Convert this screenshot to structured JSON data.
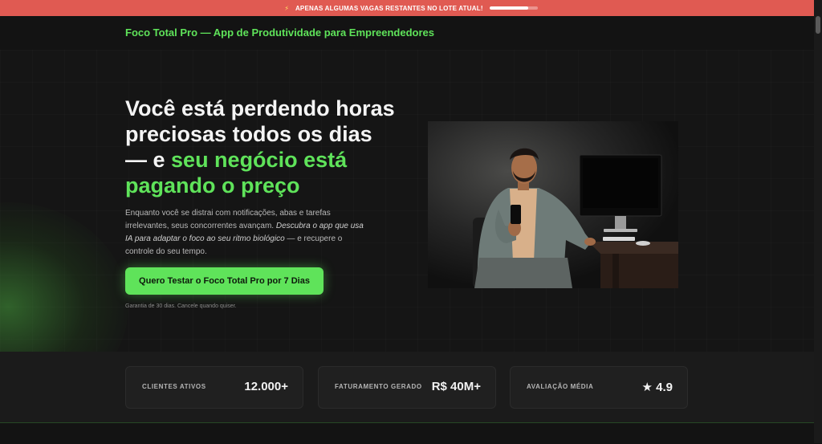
{
  "announcement": {
    "text": "APENAS ALGUMAS VAGAS RESTANTES NO LOTE ATUAL!",
    "icon": "lightning-icon",
    "progress": 0.8
  },
  "header": {
    "brand": "Foco Total Pro — App de Produtividade para Empreendedores"
  },
  "hero": {
    "headline_plain": "Você está perdendo horas preciosas todos os dias — e ",
    "headline_accent": "seu negócio está pagando o preço",
    "description_plain": "Enquanto você se distrai com notificações, abas e tarefas irrelevantes, seus concorrentes avançam. ",
    "description_italic": "Descubra o app que usa IA para adaptar o foco ao seu ritmo biológico",
    "description_end": " — e recupere o controle do seu tempo.",
    "cta_label": "Quero Testar o Foco Total Pro por 7 Dias",
    "guarantee": "Garantia de 30 dias. Cancele quando quiser."
  },
  "stats": [
    {
      "label": "CLIENTES ATIVOS",
      "value": "12.000+"
    },
    {
      "label": "FATURAMENTO GERADO",
      "value": "R$ 40M+"
    },
    {
      "label": "AVALIAÇÃO MÉDIA",
      "value": "★ 4.9"
    }
  ],
  "colors": {
    "accent": "#5fe35a",
    "banner": "#e05a52",
    "background": "#111111"
  }
}
